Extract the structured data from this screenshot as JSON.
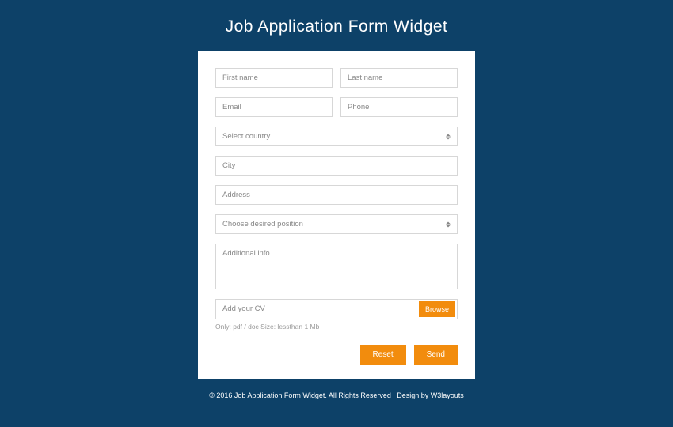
{
  "page": {
    "title": "Job Application Form Widget"
  },
  "form": {
    "first_name_placeholder": "First name",
    "last_name_placeholder": "Last name",
    "email_placeholder": "Email",
    "phone_placeholder": "Phone",
    "country_placeholder": "Select country",
    "city_placeholder": "City",
    "address_placeholder": "Address",
    "position_placeholder": "Choose desired position",
    "info_placeholder": "Additional info",
    "cv_placeholder": "Add your CV",
    "browse_label": "Browse",
    "cv_hint": "Only: pdf / doc Size: lessthan 1 Mb",
    "reset_label": "Reset",
    "send_label": "Send"
  },
  "footer": {
    "text": "© 2016 Job Application Form Widget. All Rights Reserved | Design by W3layouts"
  }
}
